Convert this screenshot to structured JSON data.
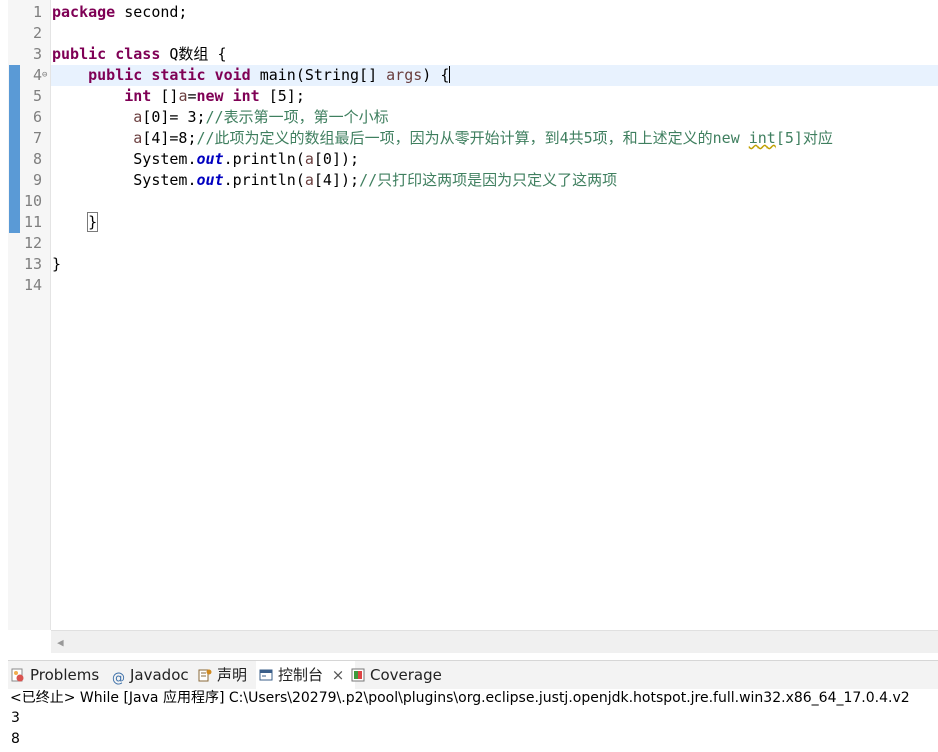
{
  "editor": {
    "lines": [
      {
        "n": "1",
        "parts": [
          {
            "c": "kw",
            "t": "package"
          },
          {
            "t": " second;"
          }
        ]
      },
      {
        "n": "2",
        "parts": []
      },
      {
        "n": "3",
        "parts": [
          {
            "c": "kw",
            "t": "public"
          },
          {
            "t": " "
          },
          {
            "c": "kw",
            "t": "class"
          },
          {
            "t": " Q数组 {"
          }
        ]
      },
      {
        "n": "4",
        "parts": [
          {
            "t": "    "
          },
          {
            "c": "kw",
            "t": "public"
          },
          {
            "t": " "
          },
          {
            "c": "kw",
            "t": "static"
          },
          {
            "t": " "
          },
          {
            "c": "kw",
            "t": "void"
          },
          {
            "t": " main(String[] "
          },
          {
            "c": "var",
            "t": "args"
          },
          {
            "t": ") {"
          }
        ]
      },
      {
        "n": "5",
        "parts": [
          {
            "t": "        "
          },
          {
            "c": "kw",
            "t": "int"
          },
          {
            "t": " []"
          },
          {
            "c": "var",
            "t": "a"
          },
          {
            "t": "="
          },
          {
            "c": "kw",
            "t": "new"
          },
          {
            "t": " "
          },
          {
            "c": "kw",
            "t": "int"
          },
          {
            "t": " [5];"
          }
        ]
      },
      {
        "n": "6",
        "parts": [
          {
            "t": "         "
          },
          {
            "c": "var",
            "t": "a"
          },
          {
            "t": "[0]= 3;"
          },
          {
            "c": "cm",
            "t": "//表示第一项，第一个小标"
          }
        ]
      },
      {
        "n": "7",
        "parts": [
          {
            "t": "         "
          },
          {
            "c": "var",
            "t": "a"
          },
          {
            "t": "[4]=8;"
          },
          {
            "c": "cm",
            "t": "//此项为定义的数组最后一项，因为从零开始计算，到4共5项，和上述定义的new "
          },
          {
            "c": "cm warn",
            "t": "int"
          },
          {
            "c": "cm",
            "t": "[5]对应"
          }
        ]
      },
      {
        "n": "8",
        "parts": [
          {
            "t": "         System."
          },
          {
            "c": "fld",
            "t": "out"
          },
          {
            "t": ".println("
          },
          {
            "c": "var",
            "t": "a"
          },
          {
            "t": "[0]);"
          }
        ]
      },
      {
        "n": "9",
        "parts": [
          {
            "t": "         System."
          },
          {
            "c": "fld",
            "t": "out"
          },
          {
            "t": ".println("
          },
          {
            "c": "var",
            "t": "a"
          },
          {
            "t": "[4]);"
          },
          {
            "c": "cm",
            "t": "//只打印这两项是因为只定义了这两项"
          }
        ]
      },
      {
        "n": "10",
        "parts": []
      },
      {
        "n": "11",
        "parts": [
          {
            "t": "    "
          },
          {
            "c": "brk",
            "t": "}"
          }
        ]
      },
      {
        "n": "12",
        "parts": []
      },
      {
        "n": "13",
        "parts": [
          {
            "t": "}"
          }
        ]
      },
      {
        "n": "14",
        "parts": []
      }
    ],
    "fold_marker": "⊖"
  },
  "tabs": [
    {
      "label": "Problems",
      "icon": "problems-icon"
    },
    {
      "label": "Javadoc",
      "icon": "javadoc-icon"
    },
    {
      "label": "声明",
      "icon": "declaration-icon"
    },
    {
      "label": "控制台",
      "icon": "console-icon",
      "close": "×"
    },
    {
      "label": "Coverage",
      "icon": "coverage-icon"
    }
  ],
  "console": {
    "header": "<已终止> While [Java 应用程序] C:\\Users\\20279\\.p2\\pool\\plugins\\org.eclipse.justj.openjdk.hotspot.jre.full.win32.x86_64_17.0.4.v2",
    "output": [
      "3",
      "8"
    ]
  },
  "colors": {
    "keyword": "#7f0055",
    "comment": "#3f7f5f",
    "field": "#0000c0",
    "variable": "#6a3e3e",
    "current_line": "#e8f2fe",
    "change_marker": "#5a9ad6"
  }
}
